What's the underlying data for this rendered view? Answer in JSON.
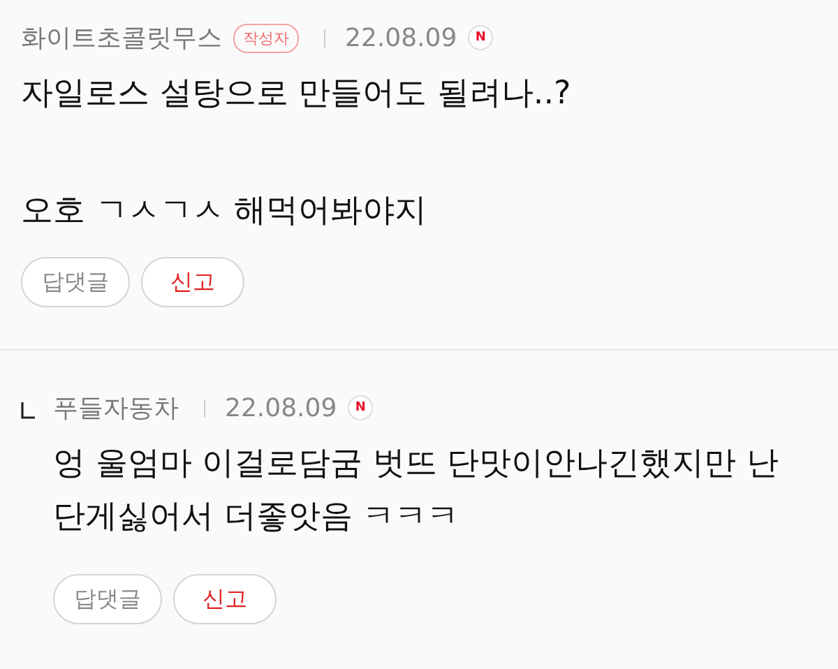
{
  "comments": [
    {
      "kind": "comment",
      "author": "화이트초콜릿무스",
      "author_badge": "작성자",
      "date": "22.08.09",
      "new_badge": "N",
      "paragraphs": [
        "자일로스 설탕으로 만들어도 될려나..?",
        "오호 ㄱㅅㄱㅅ 해먹어봐야지"
      ],
      "buttons": [
        {
          "label": "답댓글",
          "kind": "reply"
        },
        {
          "label": "신고",
          "kind": "report"
        }
      ]
    },
    {
      "kind": "reply",
      "author": "푸들자동차",
      "date": "22.08.09",
      "new_badge": "N",
      "paragraphs": [
        "엉 울엄마 이걸로담굼 벗뜨 단맛이안나긴했지만 난 단게싫어서 더좋앗음 ㅋㅋㅋ"
      ],
      "buttons": [
        {
          "label": "답댓글",
          "kind": "reply"
        },
        {
          "label": "신고",
          "kind": "report"
        }
      ]
    }
  ]
}
